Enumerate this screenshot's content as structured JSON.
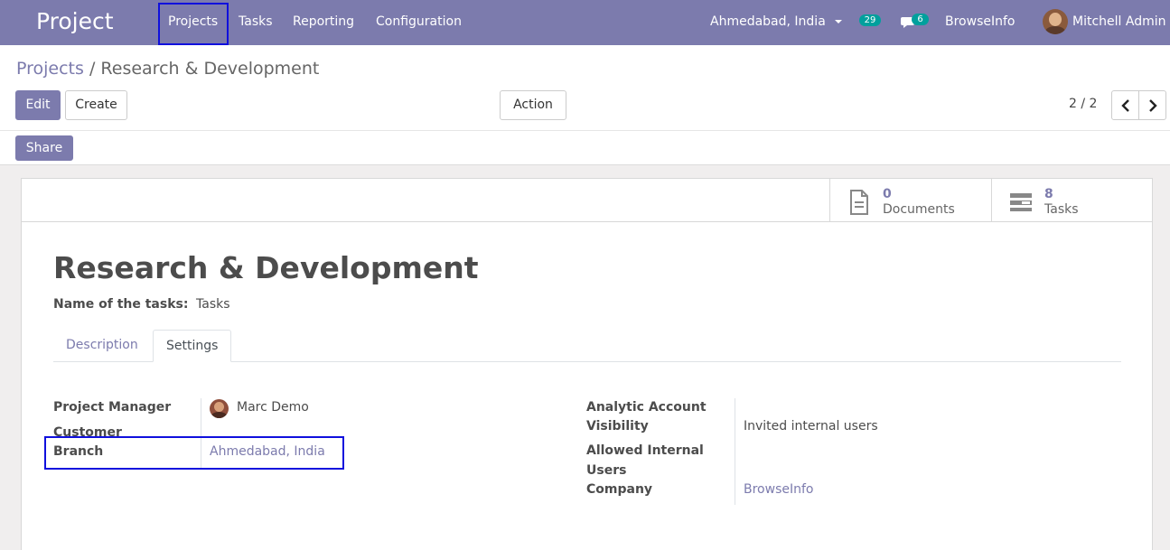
{
  "navbar": {
    "app_title": "Project",
    "menu": [
      "Projects",
      "Tasks",
      "Reporting",
      "Configuration"
    ],
    "branch_selector": "Ahmedabad, India",
    "activity_count": "29",
    "message_count": "6",
    "company": "BrowseInfo",
    "user": "Mitchell Admin"
  },
  "breadcrumb": {
    "parent": "Projects",
    "separator": "/",
    "current": "Research & Development"
  },
  "toolbar": {
    "edit_label": "Edit",
    "create_label": "Create",
    "action_label": "Action",
    "share_label": "Share"
  },
  "pager": {
    "value": "2 / 2"
  },
  "stat_buttons": [
    {
      "value": "0",
      "label": "Documents",
      "icon": "document-icon"
    },
    {
      "value": "8",
      "label": "Tasks",
      "icon": "tasks-icon"
    }
  ],
  "record": {
    "title": "Research & Development",
    "task_name_label": "Name of the tasks:",
    "task_name_value": "Tasks"
  },
  "tabs": [
    "Description",
    "Settings"
  ],
  "settings": {
    "left": {
      "project_manager_label": "Project Manager",
      "project_manager_value": "Marc Demo",
      "customer_label": "Customer",
      "branch_label": "Branch",
      "branch_value": "Ahmedabad, India"
    },
    "right": {
      "analytic_label_1": "Analytic Account",
      "visibility_label": "Visibility",
      "visibility_value": "Invited internal users",
      "allowed_label_1": "Allowed Internal",
      "allowed_label_2": "Users",
      "company_label": "Company",
      "company_value": "BrowseInfo"
    }
  },
  "colors": {
    "primary": "#7c7bad",
    "badge": "#00a09d",
    "highlight_box": "#1010dd"
  }
}
